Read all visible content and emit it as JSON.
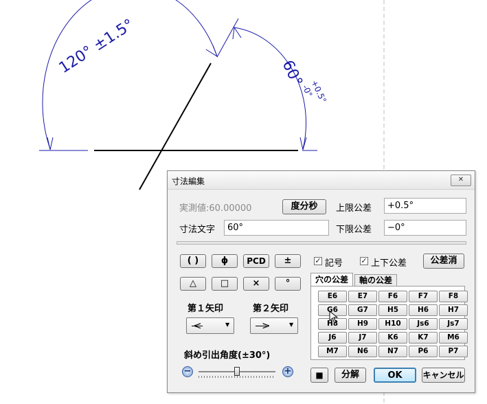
{
  "drawing": {
    "dim_120_text": "120° ±1.5°",
    "dim_60_main": "60°",
    "dim_60_upper": "+0.5°",
    "dim_60_lower": "-0°"
  },
  "dialog": {
    "title": "寸法編集",
    "close_glyph": "✕",
    "measured_label": "実測値:",
    "measured_value": "60.00000",
    "dms_button": "度分秒",
    "upper_tol_label": "上限公差",
    "upper_tol_value": "+0.5°",
    "dim_text_label": "寸法文字",
    "dim_text_value": "60°",
    "lower_tol_label": "下限公差",
    "lower_tol_value": "−0°",
    "symbol_buttons": [
      "( )",
      "ϕ",
      "PCD",
      "±",
      "△",
      "□",
      "×",
      "°"
    ],
    "symbol_checkbox_label": "記号",
    "updown_tol_checkbox_label": "上下公差",
    "clear_tol_button": "公差消",
    "tab_hole": "穴の公差",
    "tab_shaft": "軸の公差",
    "fits": [
      [
        "E6",
        "E7",
        "F6",
        "F7",
        "F8"
      ],
      [
        "G6",
        "G7",
        "H5",
        "H6",
        "H7"
      ],
      [
        "H8",
        "H9",
        "H10",
        "Js6",
        "Js7"
      ],
      [
        "J6",
        "J7",
        "K6",
        "K7",
        "M6"
      ],
      [
        "M7",
        "N6",
        "N7",
        "P6",
        "P7"
      ]
    ],
    "arrow1_label": "第１矢印",
    "arrow2_label": "第２矢印",
    "arrow1_value": "<",
    "arrow2_value": ">",
    "leader_angle_label": "斜め引出角度(±30°)",
    "minus_glyph": "−",
    "plus_glyph": "+",
    "slider_level": 0.5,
    "stop_button": "■",
    "explode_button": "分解",
    "ok_button": "OK",
    "cancel_button": "キャンセル"
  },
  "colors": {
    "dimension": "#1a1aa8",
    "ok_border": "#3c7fb1"
  }
}
